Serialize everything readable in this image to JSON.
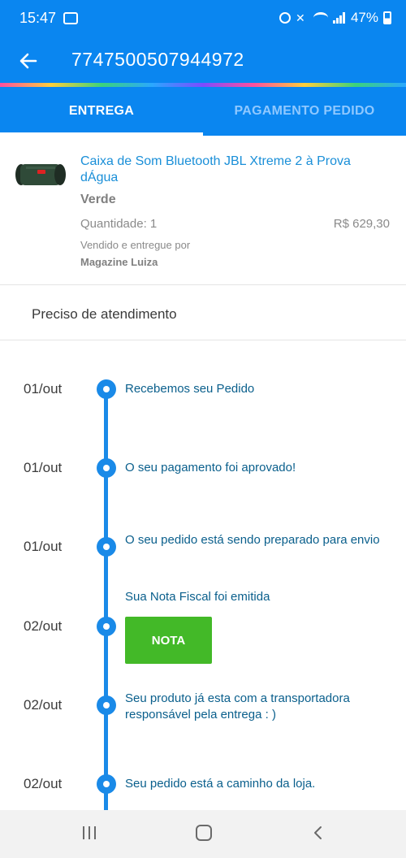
{
  "status_bar": {
    "time": "15:47",
    "battery": "47%"
  },
  "app_bar": {
    "title": "7747500507944972"
  },
  "tabs": [
    {
      "label": "ENTREGA",
      "active": true
    },
    {
      "label": "PAGAMENTO PEDIDO",
      "active": false
    }
  ],
  "product": {
    "name": "Caixa de Som Bluetooth JBL Xtreme 2 à Prova dÁgua",
    "color": "Verde",
    "quantity": "Quantidade: 1",
    "price": "R$ 629,30",
    "sold_by_label": "Vendido e entregue por",
    "seller": "Magazine Luiza"
  },
  "help": {
    "label": "Preciso de atendimento"
  },
  "timeline": [
    {
      "date": "01/out",
      "text": "Recebemos seu Pedido"
    },
    {
      "date": "01/out",
      "text": "O seu pagamento foi aprovado!"
    },
    {
      "date": "01/out",
      "text": "O seu pedido está sendo preparado para envio"
    },
    {
      "date": "02/out",
      "text": "Sua Nota Fiscal foi emitida",
      "button": "NOTA"
    },
    {
      "date": "02/out",
      "text": "Seu produto já esta com a transportadora responsável pela entrega : )"
    },
    {
      "date": "02/out",
      "text": "Seu pedido está a caminho da loja."
    }
  ],
  "colors": {
    "primary": "#0a86f0",
    "timeline": "#1a8ae8",
    "product_link": "#1a8fd8",
    "nota_button": "#43b928"
  }
}
